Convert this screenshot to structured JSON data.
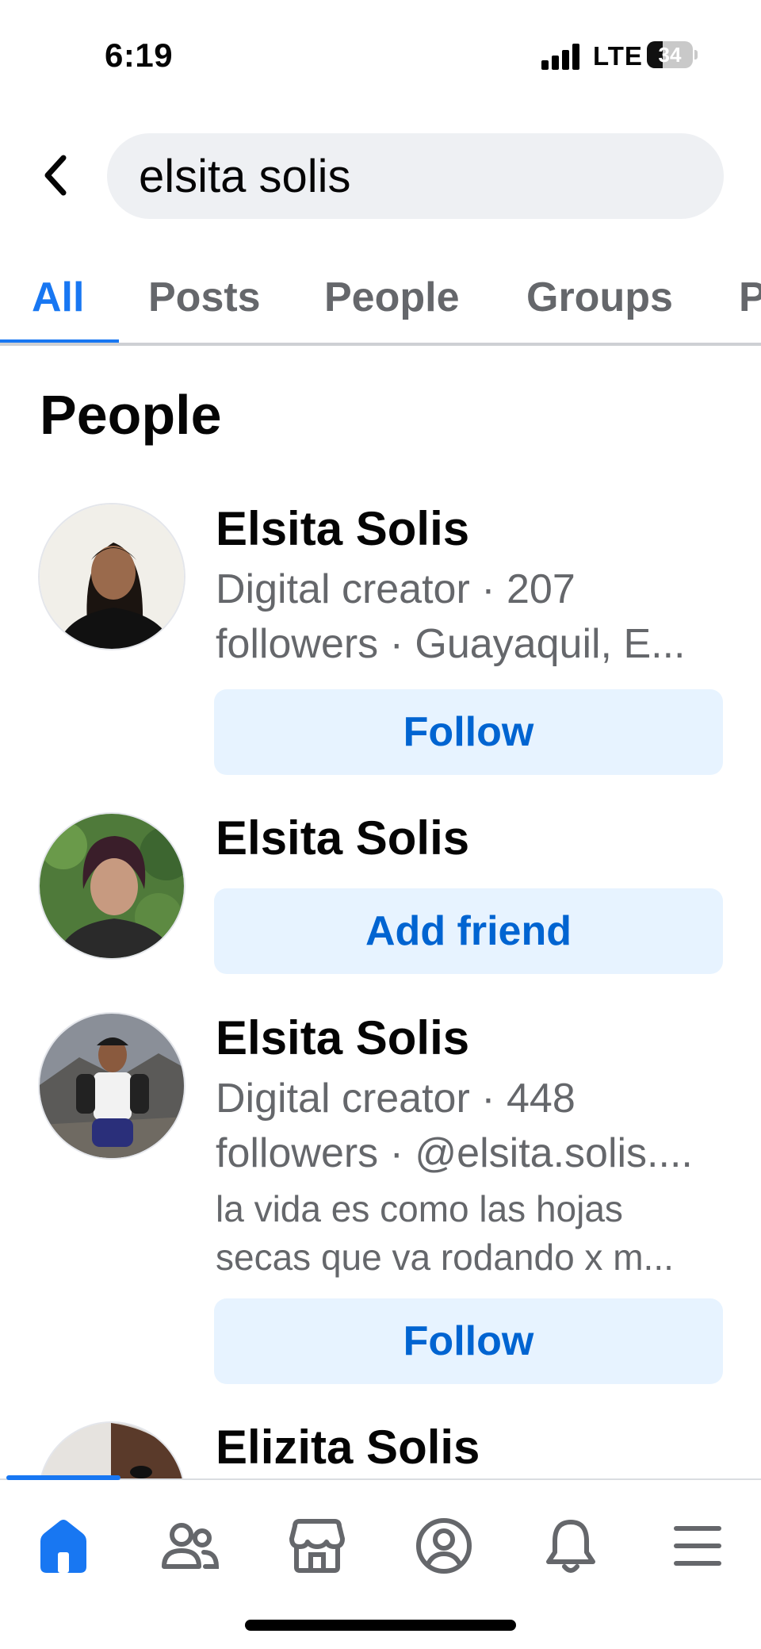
{
  "status_bar": {
    "time": "6:19",
    "network": "LTE",
    "battery_level": "34",
    "battery_fraction": 0.34
  },
  "search": {
    "query": "elsita solis",
    "back_icon": "chevron-left-icon"
  },
  "tabs": [
    {
      "label": "All",
      "active": true
    },
    {
      "label": "Posts",
      "active": false
    },
    {
      "label": "People",
      "active": false
    },
    {
      "label": "Groups",
      "active": false
    },
    {
      "label": "P",
      "active": false
    }
  ],
  "section": {
    "title": "People"
  },
  "people": [
    {
      "name": "Elsita Solis",
      "meta_line_1": "Digital creator · 207",
      "meta_line_2": "followers · Guayaquil, E...",
      "action": "Follow"
    },
    {
      "name": "Elsita Solis",
      "action": "Add friend"
    },
    {
      "name": "Elsita Solis",
      "meta_line_1": "Digital creator · 448",
      "meta_line_2": "followers · @elsita.solis....",
      "bio_line_1": "la vida es como las hojas",
      "bio_line_2": "secas que va rodando x m...",
      "action": "Follow"
    },
    {
      "name": "Elizita Solis"
    }
  ],
  "bottom_nav": {
    "items": [
      "home-icon",
      "friends-icon",
      "marketplace-icon",
      "profile-icon",
      "notifications-bell-icon",
      "menu-icon"
    ],
    "active": "home-icon"
  },
  "colors": {
    "accent": "#1877f2",
    "button_bg": "#e7f3ff",
    "button_text": "#0064d1",
    "secondary_text": "#65676b"
  }
}
